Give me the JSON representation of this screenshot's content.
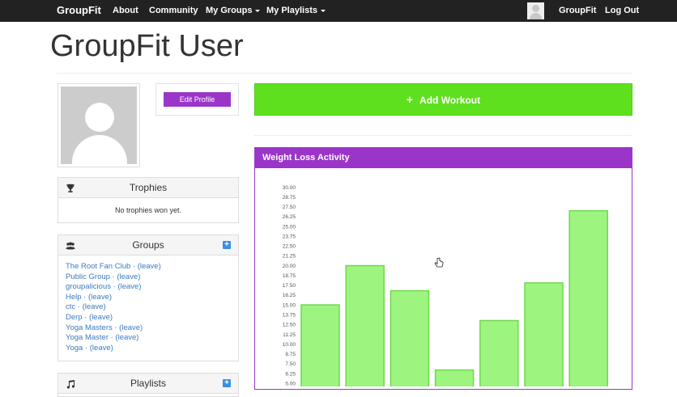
{
  "navbar": {
    "brand": "GroupFit",
    "links": {
      "about": "About",
      "community": "Community",
      "my_groups": "My Groups",
      "my_playlists": "My Playlists"
    },
    "user_name": "GroupFit",
    "logout": "Log Out"
  },
  "page": {
    "title": "GroupFit User",
    "edit_profile": "Edit Profile",
    "add_workout": "Add Workout"
  },
  "trophies": {
    "title": "Trophies",
    "empty": "No trophies won yet."
  },
  "groups": {
    "title": "Groups",
    "items": [
      "The Root Fan Club · (leave)",
      "Public Group · (leave)",
      "groupalicious · (leave)",
      "Help · (leave)",
      "ctc · (leave)",
      "Derp · (leave)",
      "Yoga Masters · (leave)",
      "Yoga Master · (leave)",
      "Yoga · (leave)"
    ]
  },
  "playlists": {
    "title": "Playlists"
  },
  "colors": {
    "navbar": "#222222",
    "accent_purple": "#9b35c9",
    "add_workout_green": "#5fe01e",
    "bar_fill": "#9df57f",
    "bar_stroke": "#6fd94a",
    "link": "#3b7bbf"
  },
  "chart_data": {
    "type": "bar",
    "title": "Weight Loss Activity",
    "yticks": [
      "30.00",
      "28.75",
      "27.50",
      "26.25",
      "25.00",
      "23.75",
      "22.50",
      "21.25",
      "20.00",
      "18.75",
      "17.50",
      "16.25",
      "15.00",
      "13.75",
      "12.50",
      "11.25",
      "10.00",
      "8.75",
      "7.50",
      "6.25",
      "5.00"
    ],
    "ylim": [
      5,
      30
    ],
    "values": [
      15.0,
      20.0,
      16.8,
      6.7,
      13.0,
      17.8,
      27.0
    ]
  }
}
